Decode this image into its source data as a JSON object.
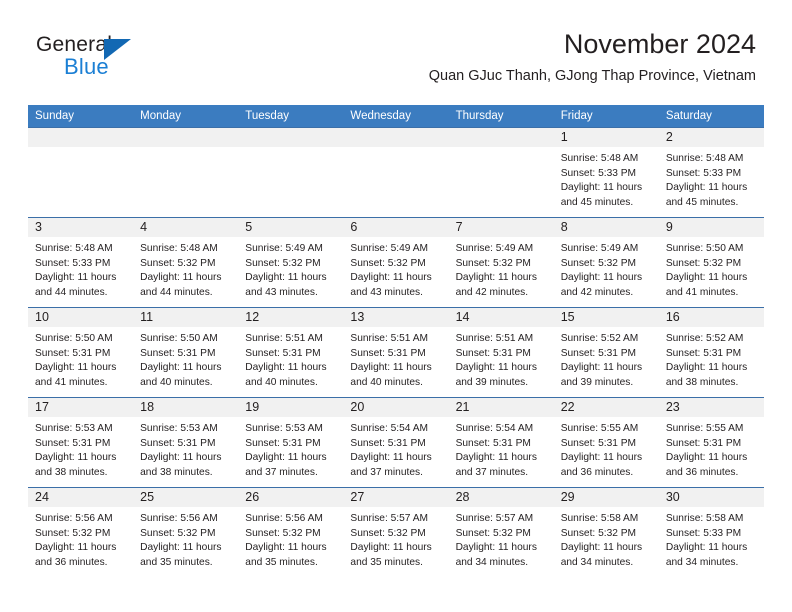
{
  "brand": {
    "line1": "General",
    "line2": "Blue",
    "triangle_color": "#1268b3",
    "line2_color": "#1b7fd4"
  },
  "header": {
    "title": "November 2024",
    "subtitle": "Quan GJuc Thanh, GJong Thap Province, Vietnam"
  },
  "theme": {
    "header_blue": "#3b7cc0",
    "row_border": "#3b6fa8",
    "daynum_band": "#f1f1f1"
  },
  "weekdays": [
    "Sunday",
    "Monday",
    "Tuesday",
    "Wednesday",
    "Thursday",
    "Friday",
    "Saturday"
  ],
  "weeks": [
    [
      {
        "day": "",
        "lines": []
      },
      {
        "day": "",
        "lines": []
      },
      {
        "day": "",
        "lines": []
      },
      {
        "day": "",
        "lines": []
      },
      {
        "day": "",
        "lines": []
      },
      {
        "day": "1",
        "lines": [
          "Sunrise: 5:48 AM",
          "Sunset: 5:33 PM",
          "Daylight: 11 hours and 45 minutes."
        ]
      },
      {
        "day": "2",
        "lines": [
          "Sunrise: 5:48 AM",
          "Sunset: 5:33 PM",
          "Daylight: 11 hours and 45 minutes."
        ]
      }
    ],
    [
      {
        "day": "3",
        "lines": [
          "Sunrise: 5:48 AM",
          "Sunset: 5:33 PM",
          "Daylight: 11 hours and 44 minutes."
        ]
      },
      {
        "day": "4",
        "lines": [
          "Sunrise: 5:48 AM",
          "Sunset: 5:32 PM",
          "Daylight: 11 hours and 44 minutes."
        ]
      },
      {
        "day": "5",
        "lines": [
          "Sunrise: 5:49 AM",
          "Sunset: 5:32 PM",
          "Daylight: 11 hours and 43 minutes."
        ]
      },
      {
        "day": "6",
        "lines": [
          "Sunrise: 5:49 AM",
          "Sunset: 5:32 PM",
          "Daylight: 11 hours and 43 minutes."
        ]
      },
      {
        "day": "7",
        "lines": [
          "Sunrise: 5:49 AM",
          "Sunset: 5:32 PM",
          "Daylight: 11 hours and 42 minutes."
        ]
      },
      {
        "day": "8",
        "lines": [
          "Sunrise: 5:49 AM",
          "Sunset: 5:32 PM",
          "Daylight: 11 hours and 42 minutes."
        ]
      },
      {
        "day": "9",
        "lines": [
          "Sunrise: 5:50 AM",
          "Sunset: 5:32 PM",
          "Daylight: 11 hours and 41 minutes."
        ]
      }
    ],
    [
      {
        "day": "10",
        "lines": [
          "Sunrise: 5:50 AM",
          "Sunset: 5:31 PM",
          "Daylight: 11 hours and 41 minutes."
        ]
      },
      {
        "day": "11",
        "lines": [
          "Sunrise: 5:50 AM",
          "Sunset: 5:31 PM",
          "Daylight: 11 hours and 40 minutes."
        ]
      },
      {
        "day": "12",
        "lines": [
          "Sunrise: 5:51 AM",
          "Sunset: 5:31 PM",
          "Daylight: 11 hours and 40 minutes."
        ]
      },
      {
        "day": "13",
        "lines": [
          "Sunrise: 5:51 AM",
          "Sunset: 5:31 PM",
          "Daylight: 11 hours and 40 minutes."
        ]
      },
      {
        "day": "14",
        "lines": [
          "Sunrise: 5:51 AM",
          "Sunset: 5:31 PM",
          "Daylight: 11 hours and 39 minutes."
        ]
      },
      {
        "day": "15",
        "lines": [
          "Sunrise: 5:52 AM",
          "Sunset: 5:31 PM",
          "Daylight: 11 hours and 39 minutes."
        ]
      },
      {
        "day": "16",
        "lines": [
          "Sunrise: 5:52 AM",
          "Sunset: 5:31 PM",
          "Daylight: 11 hours and 38 minutes."
        ]
      }
    ],
    [
      {
        "day": "17",
        "lines": [
          "Sunrise: 5:53 AM",
          "Sunset: 5:31 PM",
          "Daylight: 11 hours and 38 minutes."
        ]
      },
      {
        "day": "18",
        "lines": [
          "Sunrise: 5:53 AM",
          "Sunset: 5:31 PM",
          "Daylight: 11 hours and 38 minutes."
        ]
      },
      {
        "day": "19",
        "lines": [
          "Sunrise: 5:53 AM",
          "Sunset: 5:31 PM",
          "Daylight: 11 hours and 37 minutes."
        ]
      },
      {
        "day": "20",
        "lines": [
          "Sunrise: 5:54 AM",
          "Sunset: 5:31 PM",
          "Daylight: 11 hours and 37 minutes."
        ]
      },
      {
        "day": "21",
        "lines": [
          "Sunrise: 5:54 AM",
          "Sunset: 5:31 PM",
          "Daylight: 11 hours and 37 minutes."
        ]
      },
      {
        "day": "22",
        "lines": [
          "Sunrise: 5:55 AM",
          "Sunset: 5:31 PM",
          "Daylight: 11 hours and 36 minutes."
        ]
      },
      {
        "day": "23",
        "lines": [
          "Sunrise: 5:55 AM",
          "Sunset: 5:31 PM",
          "Daylight: 11 hours and 36 minutes."
        ]
      }
    ],
    [
      {
        "day": "24",
        "lines": [
          "Sunrise: 5:56 AM",
          "Sunset: 5:32 PM",
          "Daylight: 11 hours and 36 minutes."
        ]
      },
      {
        "day": "25",
        "lines": [
          "Sunrise: 5:56 AM",
          "Sunset: 5:32 PM",
          "Daylight: 11 hours and 35 minutes."
        ]
      },
      {
        "day": "26",
        "lines": [
          "Sunrise: 5:56 AM",
          "Sunset: 5:32 PM",
          "Daylight: 11 hours and 35 minutes."
        ]
      },
      {
        "day": "27",
        "lines": [
          "Sunrise: 5:57 AM",
          "Sunset: 5:32 PM",
          "Daylight: 11 hours and 35 minutes."
        ]
      },
      {
        "day": "28",
        "lines": [
          "Sunrise: 5:57 AM",
          "Sunset: 5:32 PM",
          "Daylight: 11 hours and 34 minutes."
        ]
      },
      {
        "day": "29",
        "lines": [
          "Sunrise: 5:58 AM",
          "Sunset: 5:32 PM",
          "Daylight: 11 hours and 34 minutes."
        ]
      },
      {
        "day": "30",
        "lines": [
          "Sunrise: 5:58 AM",
          "Sunset: 5:33 PM",
          "Daylight: 11 hours and 34 minutes."
        ]
      }
    ]
  ]
}
